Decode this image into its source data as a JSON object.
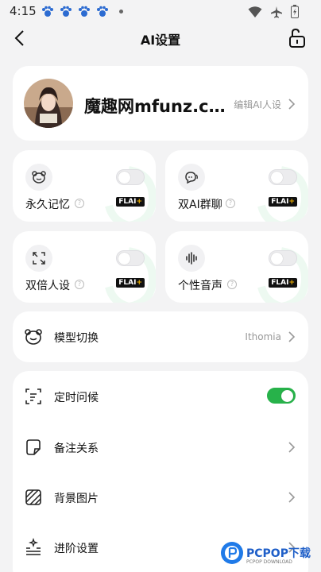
{
  "status": {
    "time": "4:15",
    "icons": [
      "paw-icon",
      "paw-icon",
      "paw-icon",
      "paw-icon",
      "dot-icon",
      "wifi-icon",
      "airplane-icon",
      "battery-icon"
    ]
  },
  "header": {
    "title": "AI设置"
  },
  "profile": {
    "name": "魔趣网mfunz.com",
    "edit_label": "编辑AI人设"
  },
  "features": [
    {
      "label": "永久记忆",
      "icon": "bear-face-icon",
      "enabled": false,
      "badge": "FLAI",
      "badge_plus": "+"
    },
    {
      "label": "双AI群聊",
      "icon": "chat-bubbles-icon",
      "enabled": false,
      "badge": "FLAI",
      "badge_plus": "+"
    },
    {
      "label": "双倍人设",
      "icon": "expand-arrows-icon",
      "enabled": false,
      "badge": "FLAI",
      "badge_plus": "+"
    },
    {
      "label": "个性音声",
      "icon": "voice-waveform-icon",
      "enabled": false,
      "badge": "FLAI",
      "badge_plus": "+"
    }
  ],
  "model": {
    "label": "模型切换",
    "value": "Ithomia"
  },
  "settings": [
    {
      "label": "定时问候",
      "icon": "scan-timer-icon",
      "type": "toggle",
      "enabled": true
    },
    {
      "label": "备注关系",
      "icon": "note-icon",
      "type": "link"
    },
    {
      "label": "背景图片",
      "icon": "image-stripes-icon",
      "type": "link"
    },
    {
      "label": "进阶设置",
      "icon": "sparkle-list-icon",
      "type": "link"
    }
  ],
  "brand": {
    "text": "PCPOP下载",
    "subtext": "PCPOP DOWNLOAD"
  },
  "colors": {
    "accent_green": "#27b24a",
    "background": "#f3f3f4",
    "card": "#ffffff",
    "brand_blue": "#1f7ae8"
  }
}
